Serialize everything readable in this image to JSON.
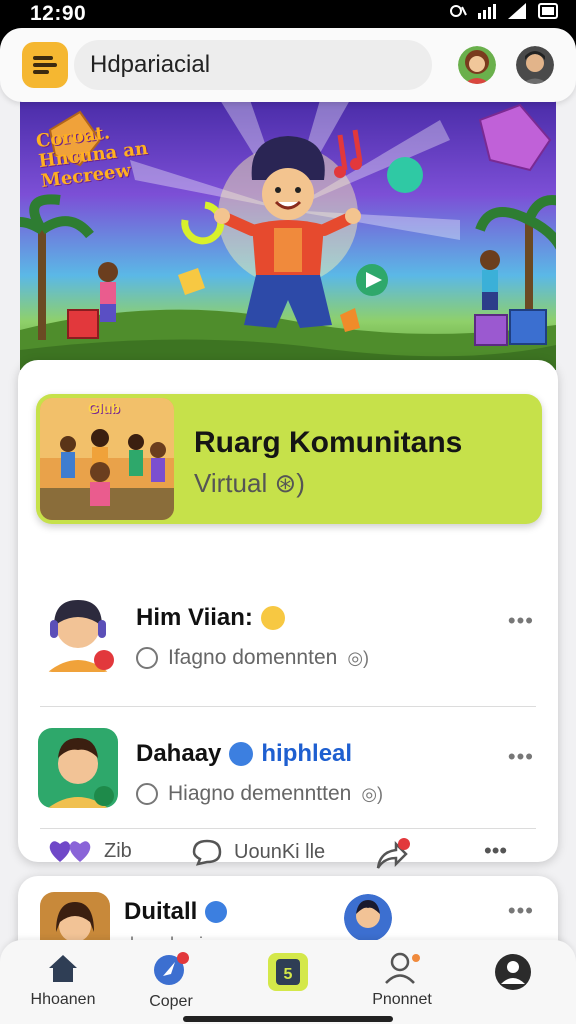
{
  "status": {
    "time": "12:90"
  },
  "header": {
    "search_value": "Hdpariacial",
    "accent_color": "#f5b731"
  },
  "banner": {
    "text_lines": [
      "Coroat.",
      "Hncuna an",
      "Mecreew"
    ]
  },
  "community_card": {
    "thumb_label": "Glub",
    "title": "Ruarg Komunitans",
    "subtitle": "Virtual ⊛)"
  },
  "posts": [
    {
      "name": "Him Viian:",
      "subtitle": "Ifagno domennten",
      "more": "•••"
    },
    {
      "name": "Dahaay",
      "badge_text": "hiphleal",
      "subtitle": "Hiagno demenntten",
      "more": "•••"
    }
  ],
  "reactions": {
    "like_count": "Zib",
    "comment_label": "UounKi lle",
    "more": "•••"
  },
  "second_card": {
    "name": "Duitall",
    "subtitle": "draanhusinan",
    "more": "•••"
  },
  "nav": {
    "items": [
      {
        "label": "Hhoanen"
      },
      {
        "label": "Coper"
      },
      {
        "label": ""
      },
      {
        "label": "Pnonnet"
      },
      {
        "label": ""
      }
    ]
  }
}
